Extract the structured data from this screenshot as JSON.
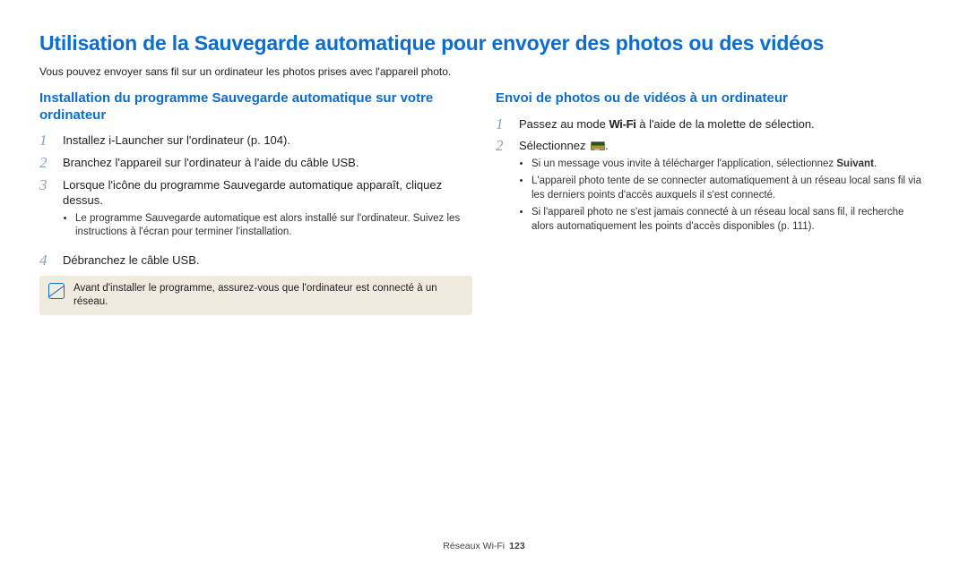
{
  "title": "Utilisation de la Sauvegarde automatique pour envoyer des photos ou des vidéos",
  "intro": "Vous pouvez envoyer sans fil sur un ordinateur les photos prises avec l'appareil photo.",
  "left": {
    "heading": "Installation du programme Sauvegarde automatique sur votre ordinateur",
    "steps": {
      "one": {
        "num": "1",
        "text": "Installez i-Launcher sur l'ordinateur (p. 104)."
      },
      "two": {
        "num": "2",
        "text": "Branchez l'appareil sur l'ordinateur à l'aide du câble USB."
      },
      "three": {
        "num": "3",
        "text": "Lorsque l'icône du programme Sauvegarde automatique apparaît, cliquez dessus.",
        "bullets": {
          "a": "Le programme Sauvegarde automatique est alors installé sur l'ordinateur. Suivez les instructions à l'écran pour terminer l'installation."
        }
      },
      "four": {
        "num": "4",
        "text": "Débranchez le câble USB."
      }
    },
    "note": "Avant d'installer le programme, assurez-vous que l'ordinateur est connecté à un réseau."
  },
  "right": {
    "heading": "Envoi de photos ou de vidéos à un ordinateur",
    "steps": {
      "one": {
        "num": "1",
        "pre": "Passez au mode ",
        "wifi": "Wi-Fi",
        "post": " à l'aide de la molette de sélection."
      },
      "two": {
        "num": "2",
        "pre": "Sélectionnez ",
        "post": ".",
        "bullets": {
          "a_prefix": "Si un message vous invite à télécharger l'application, sélectionnez ",
          "a_bold": "Suivant",
          "a_suffix": ".",
          "b": "L'appareil photo tente de se connecter automatiquement à un réseau local sans fil via les derniers points d'accès auxquels il s'est connecté.",
          "c": "Si l'appareil photo ne s'est jamais connecté à un réseau local sans fil, il recherche alors automatiquement les points d'accès disponibles (p. 111)."
        }
      }
    }
  },
  "footer": {
    "section": "Réseaux Wi-Fi",
    "page": "123"
  }
}
